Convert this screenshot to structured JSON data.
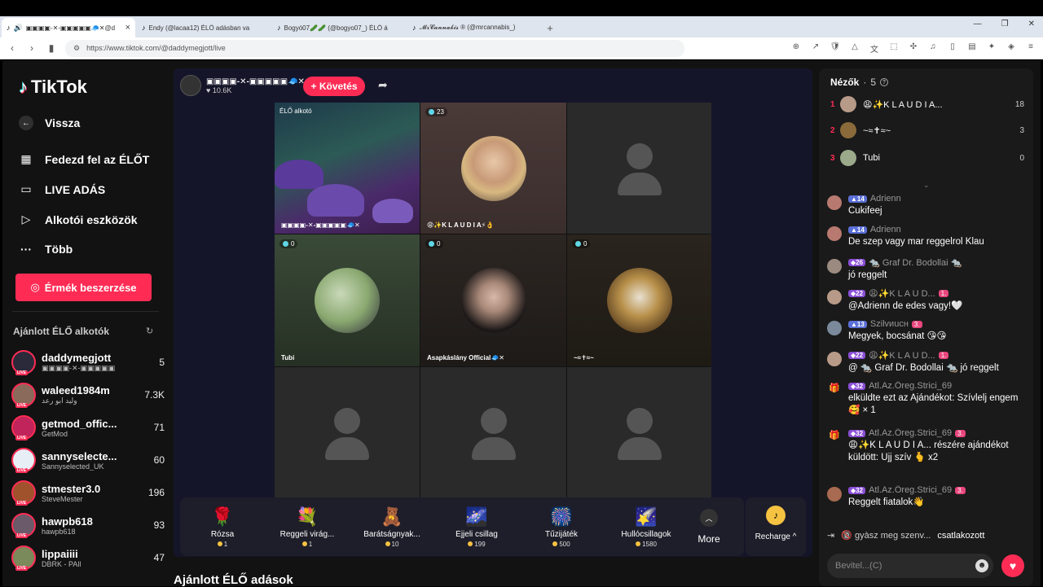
{
  "browser": {
    "tabs": [
      {
        "label": "▣▣▣▣-✕-▣▣▣▣▣🧢✕@d",
        "active": true
      },
      {
        "label": "Endy (@lacaa12) ÉLŐ adásban va",
        "active": false
      },
      {
        "label": "Bogyó07🥒🥒 (@bogyo07_) ÉLŐ á",
        "active": false
      },
      {
        "label": "𝓜𝓻𝓒𝓪𝓷𝓷𝓪𝓫𝓲𝓼 ® (@mrcannabis_)",
        "active": false
      }
    ],
    "url": "https://www.tiktok.com/@daddymegjott/live"
  },
  "sidebar": {
    "logo": "TikTok",
    "back": "Vissza",
    "nav": [
      {
        "label": "Fedezd fel az ÉLŐT",
        "icon": "calendar-icon"
      },
      {
        "label": "LIVE ADÁS",
        "icon": "camera-icon"
      },
      {
        "label": "Alkotói eszközök",
        "icon": "play-icon"
      },
      {
        "label": "Több",
        "icon": "more-icon"
      }
    ],
    "coins_button": "Érmék beszerzése",
    "recommended_title": "Ajánlott ÉLŐ alkotók",
    "live_badge": "LIVE",
    "recommended": [
      {
        "name": "daddymegjott",
        "sub": "▣▣▣▣-✕-▣▣▣▣▣",
        "count": "5"
      },
      {
        "name": "waleed1984m",
        "sub": "وليد ابو رعد",
        "count": "7.3K"
      },
      {
        "name": "getmod_offic...",
        "sub": "GetMod",
        "count": "71"
      },
      {
        "name": "sannyselecte...",
        "sub": "Sannyselected_UK",
        "count": "60"
      },
      {
        "name": "stmester3.0",
        "sub": "SteveMester",
        "count": "196"
      },
      {
        "name": "hawpb618",
        "sub": "hawpb618",
        "count": "93"
      },
      {
        "name": "lippaiiii",
        "sub": "DBRK - PAll",
        "count": "47"
      }
    ]
  },
  "stage": {
    "host_name": "▣▣▣▣-✕-▣▣▣▣▣🧢✕",
    "host_likes": "10.6K",
    "follow": "+ Követés",
    "cells": [
      {
        "badge": "ÉLŐ alkotó",
        "label": "▣▣▣▣-✕-▣▣▣▣▣🧢✕"
      },
      {
        "badge": "23",
        "label": "😩✨K L A U D I A⚡👌"
      },
      {
        "badge": "",
        "label": ""
      },
      {
        "badge": "0",
        "label": "Tubi"
      },
      {
        "badge": "0",
        "label": "Asapkáslány Official🧢✕"
      },
      {
        "badge": "0",
        "label": "~≈✝≈~"
      },
      {
        "badge": "",
        "label": ""
      },
      {
        "badge": "",
        "label": ""
      },
      {
        "badge": "",
        "label": ""
      }
    ]
  },
  "gifts": [
    {
      "name": "Rózsa",
      "price": "1",
      "icon": "🌹"
    },
    {
      "name": "Reggeli virág...",
      "price": "1",
      "icon": "💐"
    },
    {
      "name": "Barátságnyak...",
      "price": "10",
      "icon": "🧸"
    },
    {
      "name": "Éjjeli csillag",
      "price": "199",
      "icon": "🌌"
    },
    {
      "name": "Tűzijáték",
      "price": "500",
      "icon": "🎆"
    },
    {
      "name": "Hullócsillagok",
      "price": "1580",
      "icon": "🌠"
    }
  ],
  "more_label": "More",
  "recharge_label": "Recharge",
  "recommended_live_title": "Ajánlott ÉLŐ adások",
  "chat": {
    "viewers_title": "Nézők",
    "viewers_count": "5",
    "viewers": [
      {
        "rank": "1",
        "name": "😩✨K L A U D I A...",
        "score": "18"
      },
      {
        "rank": "2",
        "name": "~≈✝≈~",
        "score": "3"
      },
      {
        "rank": "3",
        "name": "Tubi",
        "score": "0"
      }
    ],
    "messages": [
      {
        "level": "14",
        "level_color": "blue",
        "fan": "",
        "name": "Adrienn",
        "text": "Cukifeej",
        "gift": false
      },
      {
        "level": "14",
        "level_color": "blue",
        "fan": "",
        "name": "Adrienn",
        "text": "De szep vagy mar reggelrol Klau",
        "gift": false
      },
      {
        "level": "26",
        "level_color": "purple",
        "fan": "",
        "name": "🐀 Graf Dr. Bodollai 🐀",
        "text": "jó reggelt",
        "gift": false
      },
      {
        "level": "22",
        "level_color": "purple",
        "fan": "1.",
        "name": "😩✨K L A U D...",
        "text": "@Adrienn de edes vagy!🤍",
        "gift": false
      },
      {
        "level": "13",
        "level_color": "blue",
        "fan": "3.",
        "name": "Szilvиuсн",
        "text": "Megyek, bocsánat 😘😘",
        "gift": false
      },
      {
        "level": "22",
        "level_color": "purple",
        "fan": "1.",
        "name": "😩✨K L A U D...",
        "text": "@ 🐀 Graf Dr. Bodollai 🐀 jó reggelt",
        "gift": false
      },
      {
        "level": "32",
        "level_color": "purple",
        "fan": "",
        "name": "Atl.Az.Öreg.Strici_69",
        "text": "elküldte ezt az Ajándékot: Szívlelj engem 🥰 × 1",
        "gift": true
      },
      {
        "level": "32",
        "level_color": "purple",
        "fan": "3.",
        "name": "Atl.Az.Öreg.Strici_69",
        "text": "😩✨K L A U D I A... részére ajándékot küldött: Ujj szív 🫰 x2",
        "gift": true
      },
      {
        "level": "32",
        "level_color": "purple",
        "fan": "3.",
        "name": "Atl.Az.Öreg.Strici_69",
        "text": "Reggelt fiatalok👋",
        "gift": false
      }
    ],
    "joined_name": "🔞 gyàsz meg szenv...",
    "joined_text": "csatlakozott",
    "input_placeholder": "Bevitel...(C)"
  },
  "colors": {
    "accent": "#fe2c55",
    "background": "#121212",
    "panel": "#1a1a1a"
  }
}
